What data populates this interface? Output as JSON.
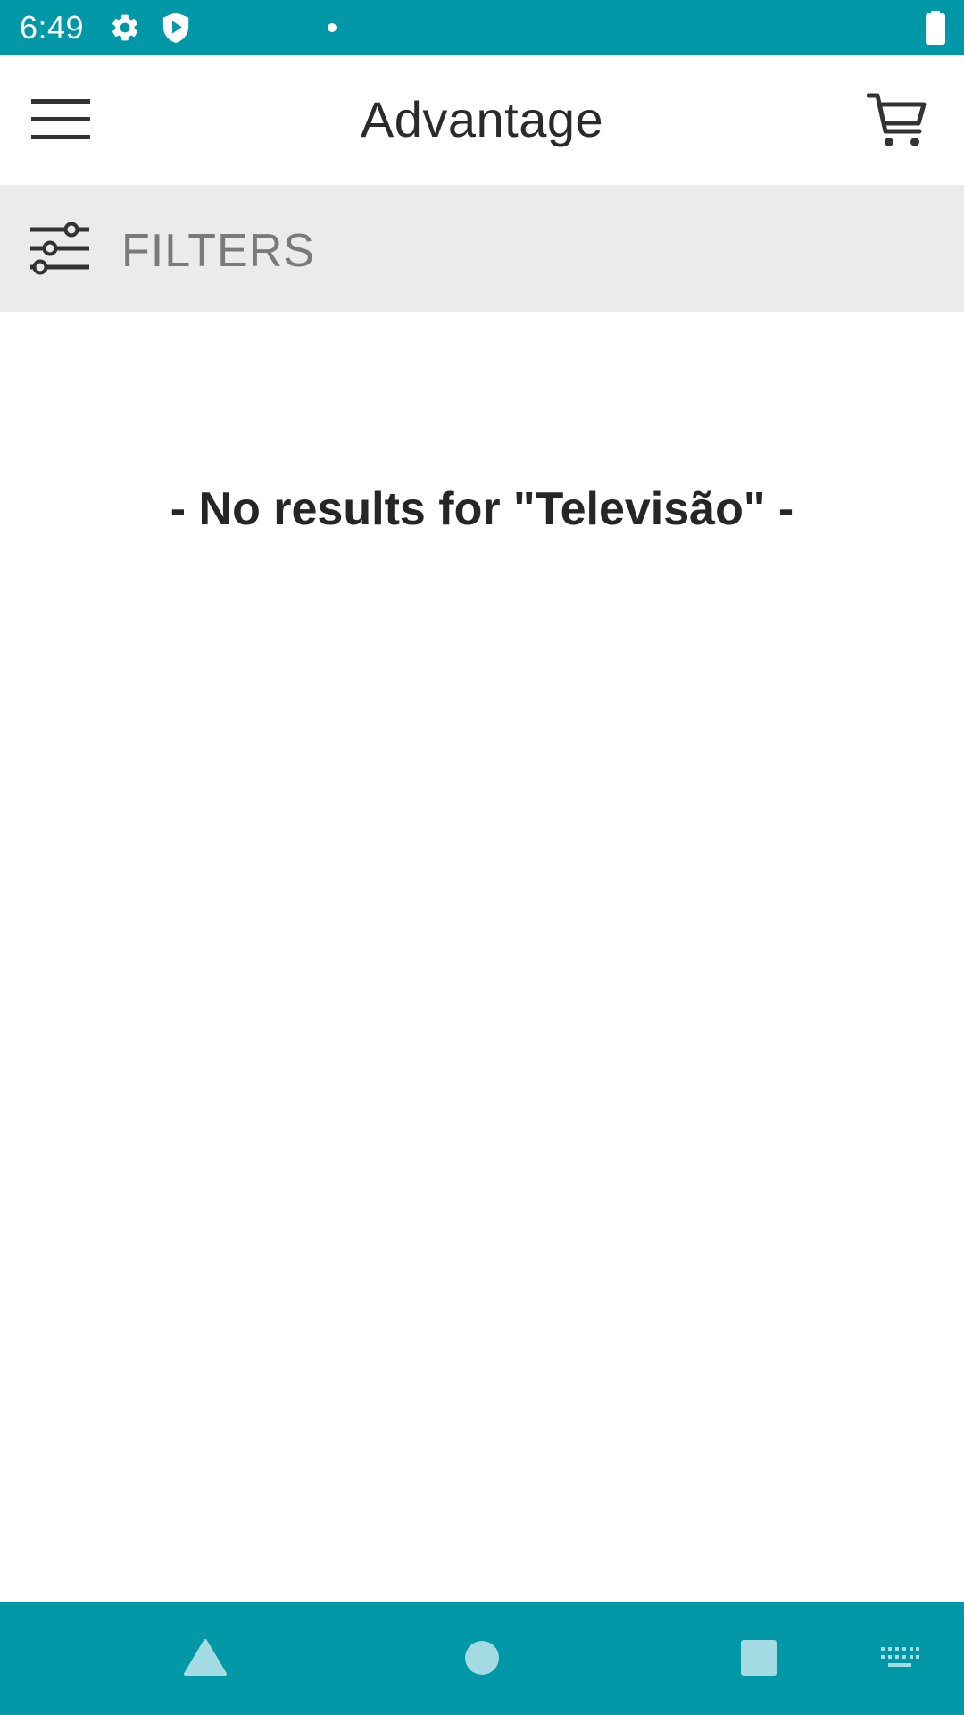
{
  "status_bar": {
    "time": "6:49",
    "icons": [
      "gear-icon",
      "shield-play-icon",
      "notification-dot-icon",
      "battery-icon"
    ],
    "background_color": "#0097a7"
  },
  "app_bar": {
    "title": "Advantage",
    "left_icon": "menu-icon",
    "right_icon": "cart-icon"
  },
  "filters": {
    "label": "FILTERS",
    "icon": "sliders-icon",
    "background_color": "#ebebeb"
  },
  "results": {
    "message": "- No results for \"Televisão\" -"
  },
  "nav_bar": {
    "buttons": [
      "back-icon",
      "home-icon",
      "recents-icon",
      "keyboard-icon"
    ],
    "background_color": "#0097a7"
  }
}
